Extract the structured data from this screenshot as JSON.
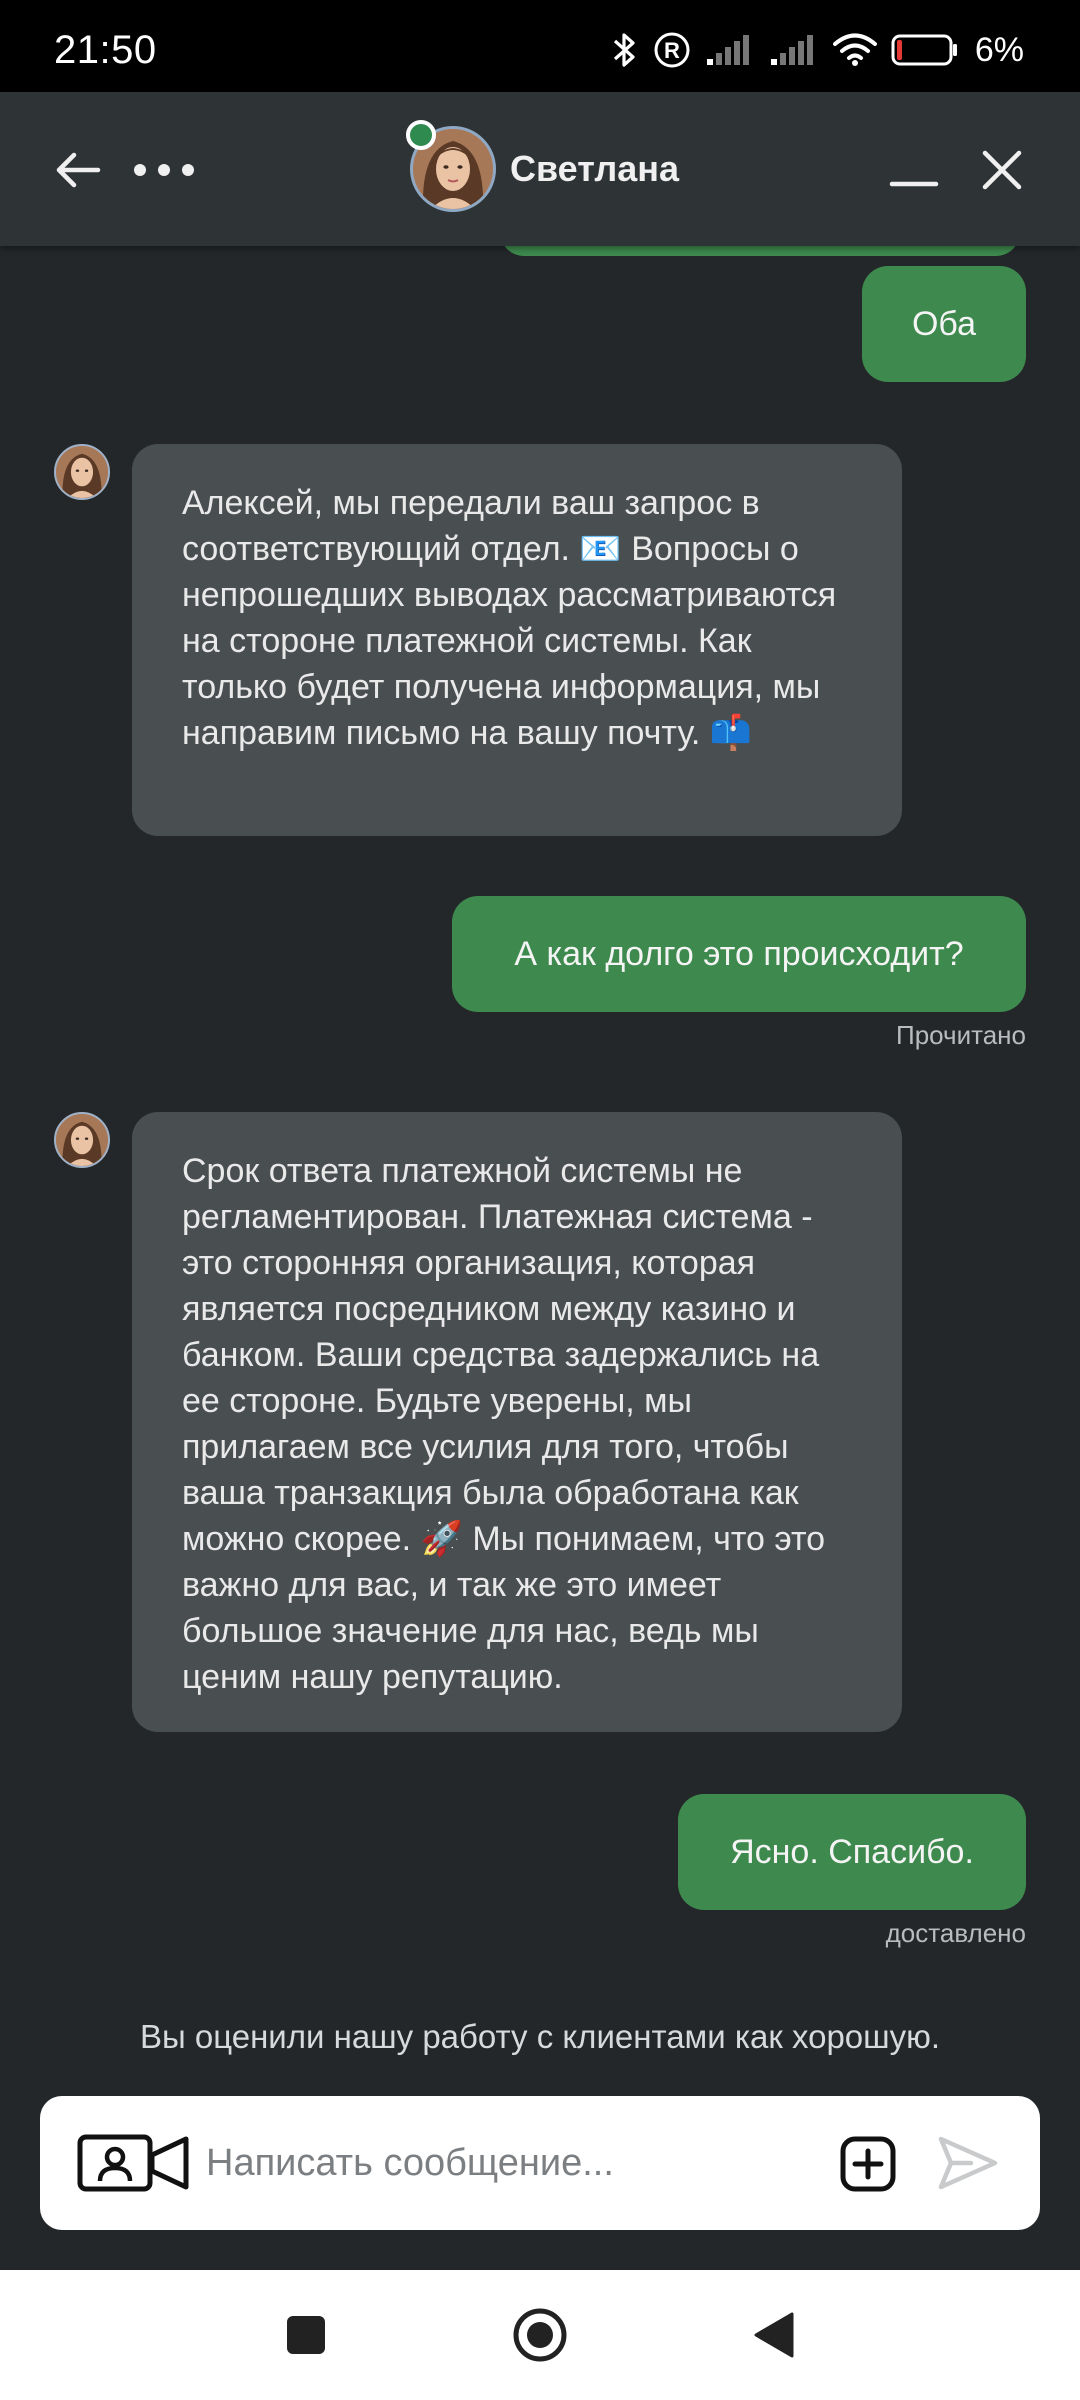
{
  "status_bar": {
    "time": "21:50",
    "battery": "6%"
  },
  "header": {
    "agent_name": "Светлана",
    "online": true
  },
  "messages": [
    {
      "type": "outgoing",
      "text": "Оба"
    },
    {
      "type": "incoming",
      "text": "Алексей, мы передали ваш запрос в соответствующий отдел. 📧 Вопросы о непрошедших выводах рассматриваются на стороне платежной системы. Как только будет получена информация, мы направим письмо на вашу почту. 📫"
    },
    {
      "type": "outgoing",
      "text": "А как долго это происходит?",
      "status": "Прочитано"
    },
    {
      "type": "incoming",
      "text": "Срок ответа платежной системы не регламентирован. Платежная система - это сторонняя организация, которая является посредником между казино и банком. Ваши средства задержались на ее стороне. Будьте уверены, мы прилагаем все усилия для того, чтобы ваша транзакция была обработана как можно скорее. 🚀 Мы понимаем, что это важно для вас, и так же это имеет большое значение для нас, ведь мы ценим нашу репутацию."
    },
    {
      "type": "outgoing",
      "text": "Ясно. Спасибо.",
      "status": "доставлено"
    }
  ],
  "rating_note": "Вы оценили нашу работу с клиентами как хорошую.",
  "composer": {
    "placeholder": "Написать сообщение..."
  },
  "colors": {
    "background": "#23272a",
    "header": "#2e3336",
    "outgoing_bubble": "#3e8a4e",
    "incoming_bubble": "#494e51",
    "online": "#2f8a4f"
  }
}
